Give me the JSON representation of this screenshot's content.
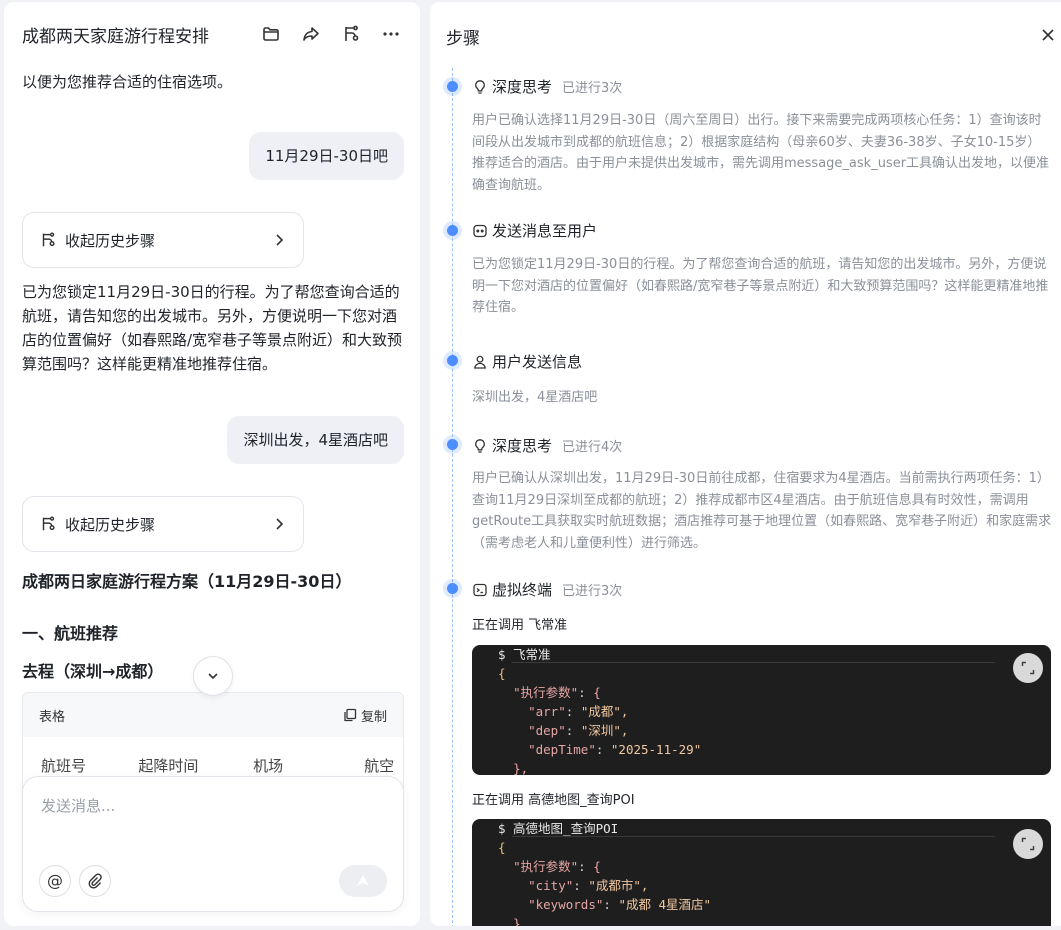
{
  "left": {
    "title": "成都两天家庭游行程安排",
    "intro_tail": "以便为您推荐合适的住宿选项。",
    "user_msg_1": "11月29日-30日吧",
    "history_label": "收起历史步骤",
    "assistant_reply": "已为您锁定11月29日-30日的行程。为了帮您查询合适的航班，请告知您的出发城市。另外，方便说明一下您对酒店的位置偏好（如春熙路/宽窄巷子等景点附近）和大致预算范围吗？这样能更精准地推荐住宿。",
    "user_msg_2": "深圳出发，4星酒店吧",
    "plan_title": "成都两日家庭游行程方案（11月29日-30日）",
    "section_1": "一、航班推荐",
    "section_1_sub": "去程（深圳→成都）",
    "table": {
      "label": "表格",
      "copy": "复制",
      "headers": [
        "航班号",
        "起降时间",
        "机场",
        "航空"
      ]
    },
    "composer_placeholder": "发送消息..."
  },
  "right": {
    "title": "步骤",
    "steps": [
      {
        "title": "深度思考",
        "badge": "已进行3次",
        "body": "用户已确认选择11月29日-30日（周六至周日）出行。接下来需要完成两项核心任务：1）查询该时间段从出发城市到成都的航班信息；2）根据家庭结构（母亲60岁、夫妻36-38岁、子女10-15岁）推荐适合的酒店。由于用户未提供出发城市，需先调用message_ask_user工具确认出发地，以便准确查询航班。"
      },
      {
        "title": "发送消息至用户",
        "badge": "",
        "body": "已为您锁定11月29日-30日的行程。为了帮您查询合适的航班，请告知您的出发城市。另外，方便说明一下您对酒店的位置偏好（如春熙路/宽窄巷子等景点附近）和大致预算范围吗？这样能更精准地推荐住宿。"
      },
      {
        "title": "用户发送信息",
        "badge": "",
        "body": "深圳出发，4星酒店吧"
      },
      {
        "title": "深度思考",
        "badge": "已进行4次",
        "body": "用户已确认从深圳出发，11月29日-30日前往成都，住宿要求为4星酒店。当前需执行两项任务：1）查询11月29日深圳至成都的航班；2）推荐成都市区4星酒店。由于航班信息具有时效性，需调用getRoute工具获取实时航班数据；酒店推荐可基于地理位置（如春熙路、宽窄巷子附近）和家庭需求（需考虑老人和儿童便利性）进行筛选。"
      },
      {
        "title": "虚拟终端",
        "badge": "已进行3次",
        "body": ""
      }
    ],
    "calls": [
      {
        "label": "正在调用 飞常准",
        "cmd": "$ 飞常准",
        "params_key": "\"执行参数\"",
        "lines": [
          {
            "k": "\"arr\"",
            "v": "\"成都\","
          },
          {
            "k": "\"dep\"",
            "v": "\"深圳\","
          },
          {
            "k": "\"depTime\"",
            "v": "\"2025-11-29\""
          }
        ]
      },
      {
        "label": "正在调用 高德地图_查询POI",
        "cmd": "$ 高德地图_查询POI",
        "params_key": "\"执行参数\"",
        "lines": [
          {
            "k": "\"city\"",
            "v": "\"成都市\","
          },
          {
            "k": "\"keywords\"",
            "v": "\"成都 4星酒店\""
          }
        ]
      }
    ]
  },
  "colors": {
    "accent": "#4c8dff",
    "muted_text": "#8a8f99",
    "code_bg": "#1e1e1e",
    "bubble_bg": "#eef0f5"
  }
}
